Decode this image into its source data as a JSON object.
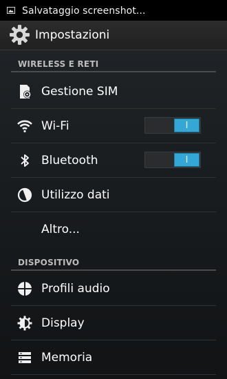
{
  "status_bar": {
    "notification_icon": "image-icon",
    "text": "Salvataggio screenshot..."
  },
  "action_bar": {
    "icon": "gear-icon",
    "title": "Impostazioni"
  },
  "sections": [
    {
      "header": "WIRELESS E RETI",
      "items": [
        {
          "label": "Gestione SIM",
          "icon": "sim-card-icon"
        },
        {
          "label": "Wi-Fi",
          "icon": "wifi-icon",
          "toggle": "I",
          "enabled": true
        },
        {
          "label": "Bluetooth",
          "icon": "bluetooth-icon",
          "toggle": "I",
          "enabled": true
        },
        {
          "label": "Utilizzo dati",
          "icon": "data-usage-icon"
        },
        {
          "label": "Altro..."
        }
      ]
    },
    {
      "header": "DISPOSITIVO",
      "items": [
        {
          "label": "Profili audio",
          "icon": "audio-profile-icon"
        },
        {
          "label": "Display",
          "icon": "display-brightness-icon"
        },
        {
          "label": "Memoria",
          "icon": "storage-icon"
        }
      ]
    }
  ],
  "colors": {
    "accent": "#33a8d6",
    "background": "#000000"
  }
}
